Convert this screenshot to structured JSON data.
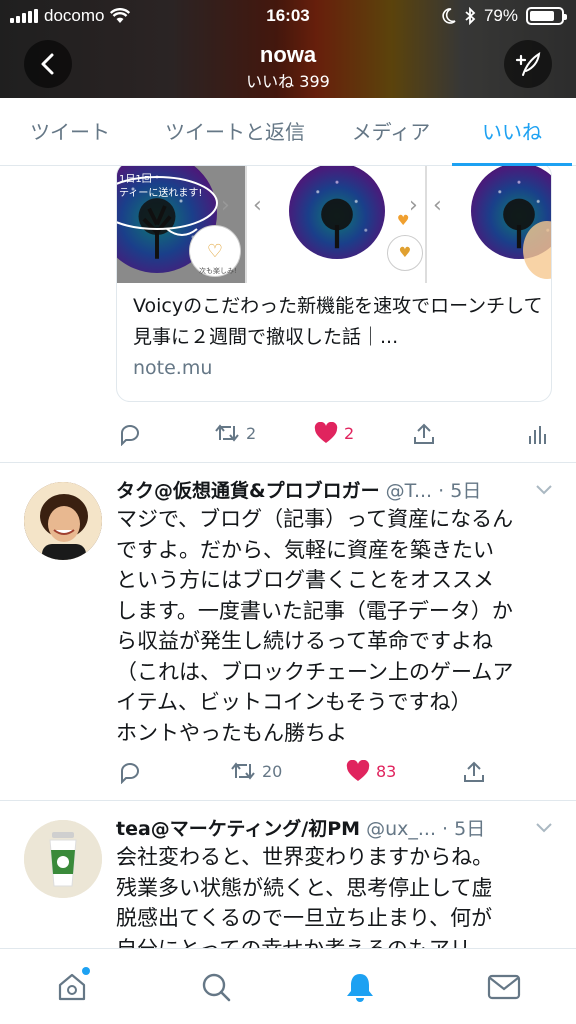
{
  "status_bar": {
    "carrier": "docomo",
    "time": "16:03",
    "battery": "79%",
    "battery_level": 0.79
  },
  "header": {
    "name": "nowa",
    "subtitle": "いいね 399"
  },
  "tabs": [
    {
      "label": "ツイート",
      "active": false
    },
    {
      "label": "ツイートと返信",
      "active": false
    },
    {
      "label": "メディア",
      "active": false
    },
    {
      "label": "いいね",
      "active": true
    }
  ],
  "link_card": {
    "image_text_1": "1日1回",
    "image_text_2": "ティーに送れます!",
    "badge_text": "次も楽しみ!",
    "title": "Voicyのこだわった新機能を速攻でローンチして見事に２週間で撤収した話｜...",
    "domain": "note.mu",
    "retweets": "2",
    "likes": "2"
  },
  "tweets": [
    {
      "name": "タク@仮想通貨&プロブロガー",
      "handle": "@T...",
      "time": "· 5日",
      "body": "マジで、ブログ（記事）って資産になるん\nですよ。だから、気軽に資産を築きたい\nという方にはブログ書くことをオススメ\nします。一度書いた記事（電子データ）か\nら収益が発生し続けるって革命ですよね\n（これは、ブロックチェーン上のゲームア\nイテム、ビットコインもそうですね）\nホントやったもん勝ちよ",
      "retweets": "20",
      "likes": "83"
    },
    {
      "name": "tea@マーケティング/初PM",
      "handle": "@ux_...",
      "time": "· 5日",
      "body": "会社変わると、世界変わりますからね。\n残業多い状態が続くと、思考停止して虚\n脱感出てくるので一旦立ち止まり、何が\n自分にとっての幸せか考えるのもアリ"
    }
  ],
  "colors": {
    "accent": "#1da1f2",
    "like": "#e0245e",
    "muted": "#657786"
  },
  "icons": {
    "back": "chevron-left-icon",
    "compose": "compose-feather-icon",
    "home": "home-icon",
    "search": "search-icon",
    "notifications": "bell-icon",
    "messages": "mail-icon"
  }
}
